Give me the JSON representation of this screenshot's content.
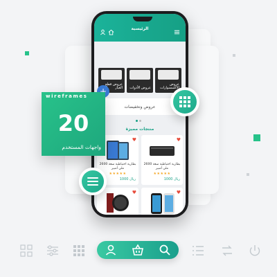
{
  "app": {
    "title": "الرئيسية"
  },
  "categories": [
    {
      "label": "عروض قطع الغيار"
    },
    {
      "label": "عروض الأدوات"
    },
    {
      "label": "عروض الاكسسوارات"
    }
  ],
  "promo": {
    "label": "عروض وتخفيضات"
  },
  "featured": {
    "label": "منتجات مميزة"
  },
  "products": [
    {
      "name": "بطارية احتياطية سعة 2600 ملي أمبير",
      "stars": "★★★★★",
      "price": "1000 ريال"
    },
    {
      "name": "بطارية احتياطية سعة 2600 ملي أمبير",
      "stars": "★★★★★",
      "price": "1000 ريال"
    },
    {
      "name": "",
      "stars": "",
      "price": ""
    },
    {
      "name": "",
      "stars": "",
      "price": ""
    }
  ],
  "badge": {
    "word": "wireframes",
    "number": "20",
    "subtitle": "واجهات المستخدم"
  },
  "colors": {
    "accent": "#16a085",
    "badge": "#24b786",
    "heart": "#e74c3c",
    "stars": "#f5a623"
  },
  "bottom_icons": [
    "grid-icon",
    "sliders-icon",
    "user-icon",
    "basket-icon",
    "search-icon",
    "list-icon",
    "transfer-icon",
    "power-icon"
  ]
}
